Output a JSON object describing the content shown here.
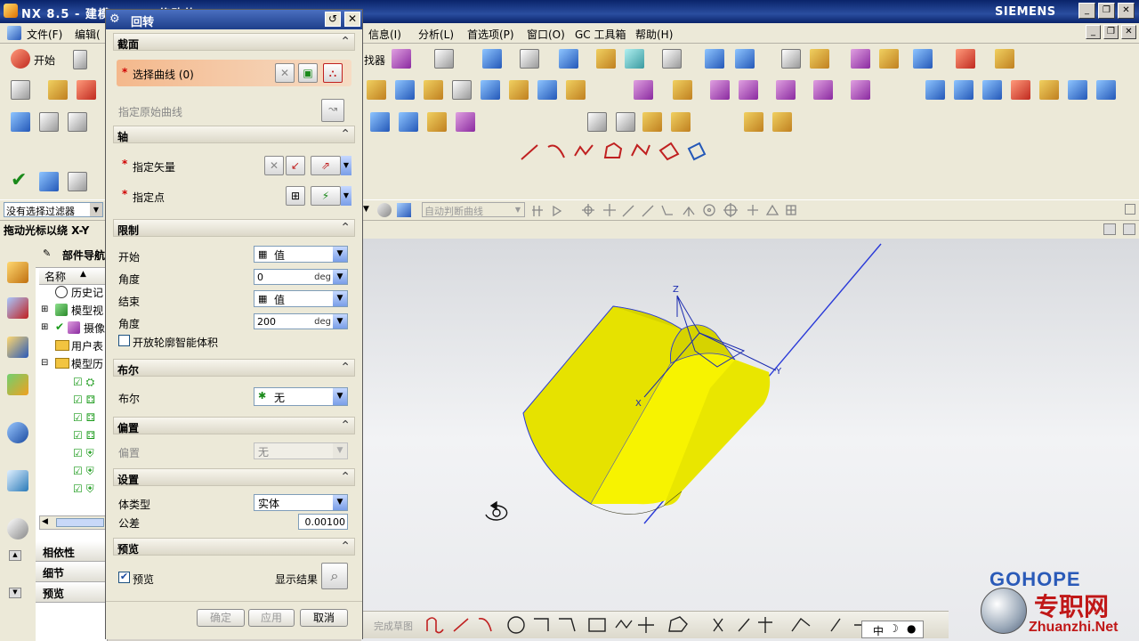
{
  "app": {
    "title": "NX 8.5 - 建模 - [... (修改的) ]",
    "brand": "SIEMENS"
  },
  "menubar": {
    "items": [
      "文件(F)",
      "编辑(",
      "信息(I)",
      "分析(L)",
      "首选项(P)",
      "窗口(O)",
      "GC 工具箱",
      "帮助(H)"
    ]
  },
  "toolbar": {
    "start_label": "开始",
    "cmd_fragment": "找器",
    "filter_value": "没有选择过滤器",
    "curve_rule": "自动判断曲线",
    "hint_text": "拖动光标以绕 X-Y",
    "finish_sketch": "完成草图"
  },
  "navigator": {
    "title": "部件导航",
    "column_name": "名称",
    "nodes": [
      "历史记",
      "模型视",
      "摄像",
      "用户表",
      "模型历"
    ],
    "bottom_panels": [
      "相依性",
      "细节",
      "预览"
    ]
  },
  "dialog": {
    "title": "回转",
    "sections": {
      "section": {
        "title": "截面",
        "select_curve": "选择曲线 (0)",
        "specify_origin_curve": "指定原始曲线"
      },
      "axis": {
        "title": "轴",
        "specify_vector": "指定矢量",
        "specify_point": "指定点"
      },
      "limits": {
        "title": "限制",
        "start_label": "开始",
        "start_value": "值",
        "start_angle_label": "角度",
        "start_angle": "0",
        "end_label": "结束",
        "end_value": "值",
        "end_angle_label": "角度",
        "end_angle": "200",
        "unit": "deg",
        "open_profile": "开放轮廓智能体积"
      },
      "boolean": {
        "title": "布尔",
        "label": "布尔",
        "value": "无"
      },
      "offset": {
        "title": "偏置",
        "label": "偏置",
        "value": "无"
      },
      "settings": {
        "title": "设置",
        "body_type_label": "体类型",
        "body_type": "实体",
        "tolerance_label": "公差",
        "tolerance": "0.00100"
      },
      "preview": {
        "title": "预览",
        "preview_label": "预览",
        "preview_checked": true,
        "show_result": "显示结果"
      }
    },
    "buttons": {
      "ok": "确定",
      "apply": "应用",
      "cancel": "取消"
    }
  },
  "viewport": {
    "axis_labels": {
      "x": "X",
      "y": "Y",
      "z": "Z"
    },
    "model_color": "#f2ee10"
  },
  "watermark": {
    "logo_text": "GOHOPE",
    "site_cn": "专职网",
    "site_url": "Zhuanzhi.Net"
  },
  "ime": {
    "label": "中"
  }
}
